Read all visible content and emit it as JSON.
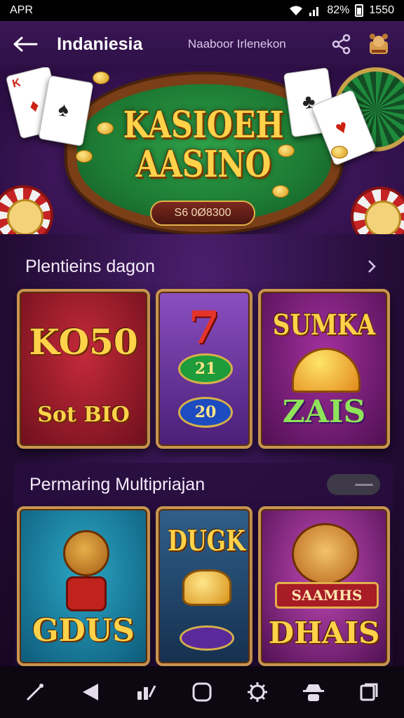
{
  "status_bar": {
    "carrier": "APR",
    "battery_text": "82%",
    "time": "1550"
  },
  "header": {
    "title": "Indaniesia",
    "subtitle": "Naaboor Irlenekon"
  },
  "banner": {
    "title_line1": "KASIOEH",
    "title_line2": "AASINO",
    "prize": "S6 0Ø8300"
  },
  "section1": {
    "title": "Plentieins dagon",
    "tiles": [
      {
        "line1": "KO50",
        "line2": "Sot BIO"
      },
      {
        "line1": "7",
        "line2": "21",
        "line3": "20"
      },
      {
        "line1": "SUMKA",
        "line2": "ZAIS"
      }
    ]
  },
  "section2": {
    "title": "Permaring Multipriajan",
    "tiles": [
      {
        "line1": "GDUS"
      },
      {
        "line1": "DUGK"
      },
      {
        "line1": "SAAMHS",
        "line2": "DHAIS"
      }
    ]
  },
  "colors": {
    "accent_gold": "#ffd24a",
    "bg_purple": "#2a0f3f",
    "frame_gold": "#c89450"
  },
  "bottom_nav": {
    "icons": [
      "wand-icon",
      "back-triangle-icon",
      "chart-edit-icon",
      "home-icon",
      "settings-gear-icon",
      "spy-icon",
      "recents-icon"
    ]
  }
}
